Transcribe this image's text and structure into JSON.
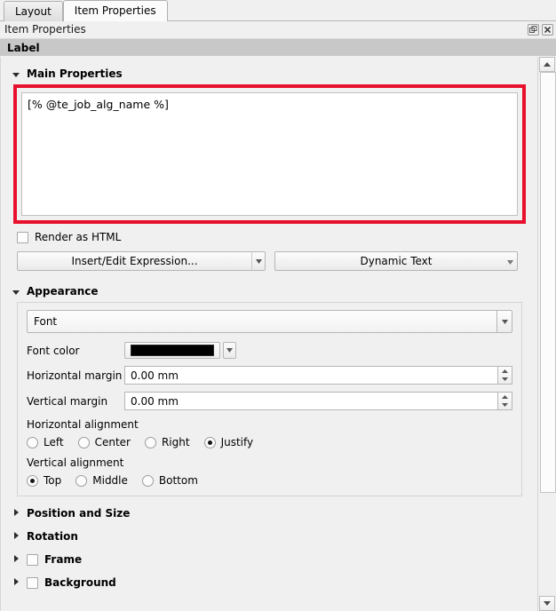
{
  "tabs": [
    {
      "label": "Layout",
      "active": false
    },
    {
      "label": "Item Properties",
      "active": true
    }
  ],
  "dock": {
    "title": "Item Properties",
    "float_icon": "float-icon",
    "close_icon": "close-icon"
  },
  "item_header": {
    "title": "Label"
  },
  "main_properties": {
    "title": "Main Properties",
    "text_value": "[% @te_job_alg_name %]",
    "render_as_html": {
      "label": "Render as HTML",
      "checked": false
    },
    "insert_expression_button": "Insert/Edit Expression...",
    "dynamic_text_button": "Dynamic Text",
    "highlight_color": "#e8112d"
  },
  "appearance": {
    "title": "Appearance",
    "font_combo_value": "Font",
    "font_color": {
      "label": "Font color",
      "value": "#000000"
    },
    "horizontal_margin": {
      "label": "Horizontal margin",
      "value": "0.00 mm"
    },
    "vertical_margin": {
      "label": "Vertical margin",
      "value": "0.00 mm"
    },
    "horizontal_alignment": {
      "label": "Horizontal alignment",
      "options": [
        "Left",
        "Center",
        "Right",
        "Justify"
      ],
      "selected": "Justify"
    },
    "vertical_alignment": {
      "label": "Vertical alignment",
      "options": [
        "Top",
        "Middle",
        "Bottom"
      ],
      "selected": "Top"
    }
  },
  "collapsed_sections": [
    {
      "title": "Position and Size",
      "has_checkbox": false,
      "checked": false
    },
    {
      "title": "Rotation",
      "has_checkbox": false,
      "checked": false
    },
    {
      "title": "Frame",
      "has_checkbox": true,
      "checked": false
    },
    {
      "title": "Background",
      "has_checkbox": true,
      "checked": false
    }
  ]
}
